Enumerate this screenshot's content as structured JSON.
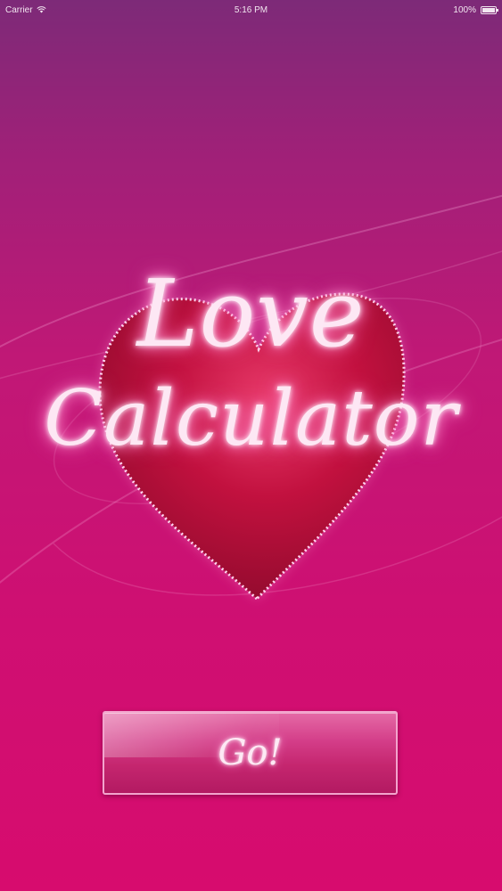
{
  "status_bar": {
    "carrier": "Carrier",
    "time": "5:16 PM",
    "battery_percent": "100%",
    "battery_level": 1.0
  },
  "logo": {
    "line1": "Love",
    "line2": "Calculator"
  },
  "go_button": {
    "label": "Go!"
  },
  "colors": {
    "background_top": "#7d2a78",
    "background_bottom": "#d70c6e",
    "heart": "#c2113f",
    "glow": "#ffd6ee"
  },
  "icons": [
    "wifi-icon",
    "battery-icon",
    "heart-icon"
  ]
}
